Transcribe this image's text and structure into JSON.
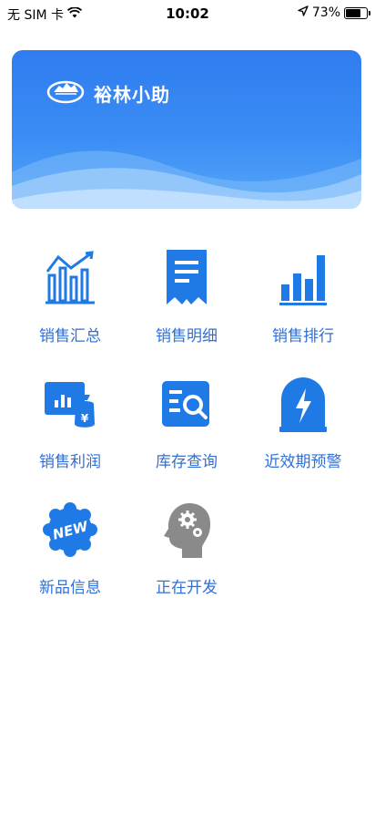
{
  "status_bar": {
    "carrier": "无 SIM 卡",
    "time": "10:02",
    "battery_percent": "73%",
    "battery_level": 0.73
  },
  "banner": {
    "title": "裕林小助"
  },
  "colors": {
    "accent": "#1f7ae6",
    "label": "#2f6fd6",
    "banner_top": "#2f7cf0",
    "gray_icon": "#8a8a8a"
  },
  "tiles": [
    {
      "label": "销售汇总",
      "icon": "sales-summary-icon"
    },
    {
      "label": "销售明细",
      "icon": "receipt-icon"
    },
    {
      "label": "销售排行",
      "icon": "bar-chart-icon"
    },
    {
      "label": "销售利润",
      "icon": "profit-icon"
    },
    {
      "label": "库存查询",
      "icon": "inventory-search-icon"
    },
    {
      "label": "近效期预警",
      "icon": "expiry-alert-icon"
    },
    {
      "label": "新品信息",
      "icon": "new-badge-icon"
    },
    {
      "label": "正在开发",
      "icon": "gear-head-icon"
    }
  ]
}
